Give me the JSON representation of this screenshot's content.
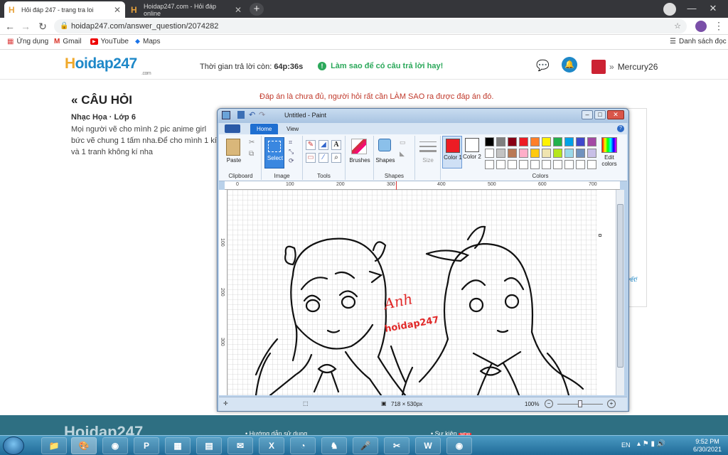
{
  "browser": {
    "tabs": [
      {
        "title": "Hỏi đáp 247 - trang tra loi",
        "active": true
      },
      {
        "title": "Hoidap247.com - Hỏi đáp online",
        "active": false
      }
    ],
    "url": "hoidap247.com/answer_question/2074282",
    "bookmarks": [
      "Ứng dụng",
      "Gmail",
      "YouTube",
      "Maps"
    ],
    "bookmarks_right": "Danh sách đọc"
  },
  "site": {
    "logo": "Hoidap247",
    "logo_sub": ".com",
    "timer_label": "Thời gian trả lời còn:",
    "timer_value": "64p:36s",
    "tip": "Làm sao để có câu trả lời hay!",
    "username": "Mercury26"
  },
  "question": {
    "heading": "CÂU HỎI",
    "category": "Nhạc Họa · Lớp 6",
    "text": "Mọi người vẽ cho mình 2 pic anime girl bức vẽ chung 1 tấm nha.Để cho mình 1 kí và 1 tranh không kí nha",
    "warning": "Đáp án là chưa đủ, người hỏi rất cần LÀM SAO ra được đáp án đó.",
    "side_link": "vết!"
  },
  "footer": {
    "logo": "Hoidap247",
    "link1": "Hướng dẫn sử dụng",
    "link2": "Sự kiện",
    "badge": "NEW"
  },
  "paint": {
    "title": "Untitled - Paint",
    "tabs": [
      "Home",
      "View"
    ],
    "groups": {
      "clipboard": "Clipboard",
      "image": "Image",
      "tools": "Tools",
      "shapes": "Shapes",
      "colors": "Colors"
    },
    "buttons": {
      "paste": "Paste",
      "select": "Select",
      "brushes": "Brushes",
      "shapes": "Shapes",
      "size": "Size",
      "color1": "Color 1",
      "color2": "Color 2",
      "edit_colors": "Edit colors"
    },
    "ruler_h": [
      "0",
      "100",
      "200",
      "300",
      "400",
      "500",
      "600",
      "700"
    ],
    "ruler_v": [
      "100",
      "200",
      "300"
    ],
    "status_size": "718 × 530px",
    "zoom": "100%",
    "palette_row1": [
      "#000000",
      "#7f7f7f",
      "#880015",
      "#ed1c24",
      "#ff7f27",
      "#fff200",
      "#22b14c",
      "#00a2e8",
      "#3f48cc",
      "#a349a4"
    ],
    "palette_row2": [
      "#ffffff",
      "#c3c3c3",
      "#b97a57",
      "#ffaec9",
      "#ffc90e",
      "#efe4b0",
      "#b5e61d",
      "#99d9ea",
      "#7092be",
      "#c8bfe7"
    ],
    "color1_value": "#ed1c24",
    "color2_value": "#ffffff",
    "signature": "Anh",
    "watermark": "hoidap247"
  },
  "taskbar": {
    "lang": "EN",
    "time": "9:52 PM",
    "date": "6/30/2021"
  }
}
